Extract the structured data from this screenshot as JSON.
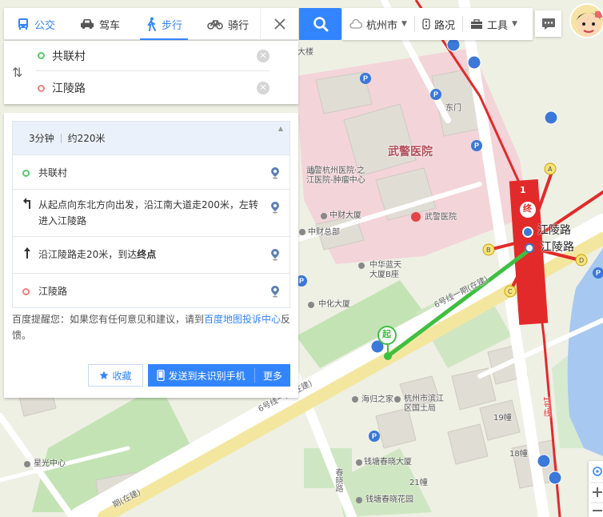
{
  "tabs": [
    {
      "label": "公交",
      "icon": "bus-icon"
    },
    {
      "label": "驾车",
      "icon": "car-icon"
    },
    {
      "label": "步行",
      "icon": "walk-icon"
    },
    {
      "label": "骑行",
      "icon": "bike-icon"
    }
  ],
  "active_tab": "步行",
  "toolbar": {
    "city": "杭州市",
    "traffic": "路况",
    "tools": "工具"
  },
  "route_input": {
    "start": "共联村",
    "end": "江陵路"
  },
  "result": {
    "duration": "3分钟",
    "distance": "约220米",
    "steps": [
      {
        "type": "start",
        "text": "共联村"
      },
      {
        "type": "turn-left",
        "text": "从起点向东北方向出发，沿江南大道走200米，左转进入江陵路"
      },
      {
        "type": "straight",
        "text_before": "沿江陵路走20米，到达",
        "text_bold": "终点"
      },
      {
        "type": "end",
        "text": "江陵路"
      }
    ],
    "tip_prefix": "百度提醒您：如果您有任何意见和建议，请到",
    "tip_link": "百度地图投诉中心",
    "tip_suffix": "反馈。",
    "fav_label": "收藏",
    "send_label": "发送到未识别手机",
    "more_label": "更多"
  },
  "map_labels": {
    "hospital": "武警医院",
    "hospital_small": "武警医院",
    "hospital_branch_1": "武警杭州医院·之",
    "hospital_branch_2": "江医院-肿瘤中心",
    "zhongcai": "中财大厦",
    "zhongcai_hq": "中财总部",
    "zhonghua_1": "中华蓝天",
    "zhonghua_2": "大厦B座",
    "zhonghua_tower": "中化大厦",
    "haigui": "海归之家",
    "binjiang_1": "杭州市滨江",
    "binjiang_2": "区国土局",
    "xingguang": "星光中心",
    "qiantang_tower": "钱塘春晓大厦",
    "qiantang_garden": "钱塘春晓花园",
    "chunxiao_road": "春晓路",
    "line6_a": "6号线一期(在建)",
    "line6_b": "6号线一期(在建)",
    "line6_c": "期(在建)",
    "line1": "1号线",
    "station_a": "江陵路",
    "station_b": "江陵路",
    "gate": "东门",
    "building_top": "大楼",
    "b19": "19幢",
    "b18": "18幢",
    "b21": "21幢",
    "exit_a": "A",
    "exit_b": "B",
    "exit_c": "C",
    "exit_d": "D",
    "start_marker": "起",
    "end_marker": "终",
    "line_badge": "1"
  },
  "colors": {
    "accent": "#3385ff",
    "route": "#3fbf3f",
    "metro_red": "#e22a2a",
    "metro_yellow": "#e8d24a"
  }
}
